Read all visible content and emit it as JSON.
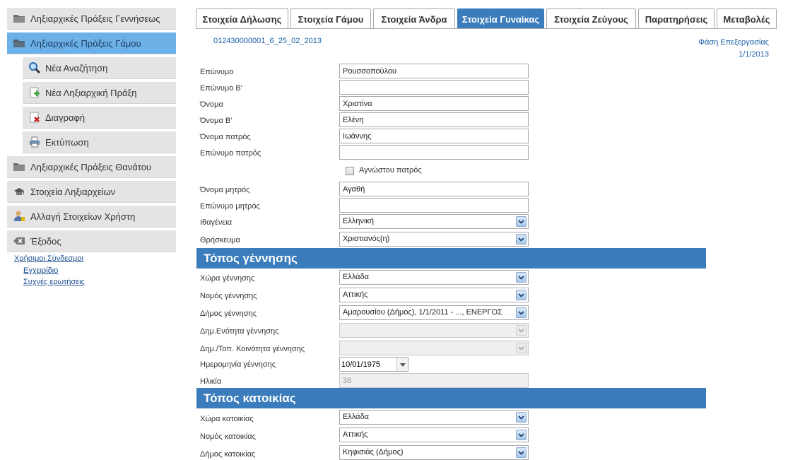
{
  "sidebar": {
    "items": [
      {
        "label": "Ληξιαρχικές Πράξεις Γεννήσεως",
        "icon": "folder-icon"
      },
      {
        "label": "Ληξιαρχικές Πράξεις Γάμου",
        "icon": "folder-icon",
        "active": true
      },
      {
        "label": "Ληξιαρχικές Πράξεις Θανάτου",
        "icon": "folder-icon"
      },
      {
        "label": "Στοιχεία Ληξιαρχείων",
        "icon": "registry-icon"
      },
      {
        "label": "Αλλαγή Στοιχείων Χρήστη",
        "icon": "user-icon"
      },
      {
        "label": "Έξοδος",
        "icon": "exit-icon"
      }
    ],
    "subitems": [
      {
        "label": "Νέα Αναζήτηση",
        "icon": "search-icon"
      },
      {
        "label": "Νέα Ληξιαρχική Πράξη",
        "icon": "add-document-icon"
      },
      {
        "label": "Διαγραφή",
        "icon": "delete-icon"
      },
      {
        "label": "Εκτύπωση",
        "icon": "print-icon"
      }
    ],
    "links_title": "Χρήσιμοι Σύνδεσμοι",
    "links": [
      "Εγχειρίδιο",
      "Συχνές ερωτήσεις"
    ]
  },
  "tabs": [
    "Στοιχεία Δήλωσης",
    "Στοιχεία Γάμου",
    "Στοιχεία Άνδρα",
    "Στοιχεία Γυναίκας",
    "Στοιχεία Ζεύγους",
    "Παρατηρήσεις",
    "Μεταβολές"
  ],
  "active_tab": "Στοιχεία Γυναίκας",
  "declaration_id": "012430000001_6_25_02_2013",
  "phase": {
    "label": "Φάση Επεξεργασίας",
    "date": "1/1/2013"
  },
  "form": {
    "surname": {
      "label": "Επώνυμο",
      "value": "Ρουσσοπούλου"
    },
    "surname_b": {
      "label": "Επώνυμο Β'",
      "value": ""
    },
    "name": {
      "label": "Όνομα",
      "value": "Χριστίνα"
    },
    "name_b": {
      "label": "Όνομα Β'",
      "value": "Ελένη"
    },
    "father_name": {
      "label": "Όνομα πατρός",
      "value": "Ιωάννης"
    },
    "father_surname": {
      "label": "Επώνυμο πατρός",
      "value": ""
    },
    "unknown_father": {
      "label": "Αγνώστου πατρός",
      "checked": false
    },
    "mother_name": {
      "label": "Όνομα μητρός",
      "value": "Αγαθή"
    },
    "mother_surname": {
      "label": "Επώνυμο μητρός",
      "value": ""
    },
    "nationality": {
      "label": "Ιθαγένεια",
      "value": "Ελληνική"
    },
    "religion": {
      "label": "Θρήσκευμα",
      "value": "Χριστιανός(η)"
    }
  },
  "birth_section": {
    "title": "Τόπος γέννησης",
    "country": {
      "label": "Χώρα γέννησης",
      "value": "Ελλάδα"
    },
    "prefecture": {
      "label": "Νομός γέννησης",
      "value": "Αττικής"
    },
    "municipality": {
      "label": "Δήμος γέννησης",
      "value": "Αμαρουσίου (Δήμος), 1/1/2011 - ..., ΕΝΕΡΓΟΣ"
    },
    "municipal_unit": {
      "label": "Δημ.Ενότητα γέννησης",
      "value": ""
    },
    "community": {
      "label": "Δημ./Τοπ. Κοινότητα γέννησης",
      "value": ""
    },
    "birth_date": {
      "label": "Ημερομηνία γέννησης",
      "value": "10/01/1975"
    },
    "age": {
      "label": "Ηλικία",
      "value": "38"
    }
  },
  "residence_section": {
    "title": "Τόπος κατοικίας",
    "country": {
      "label": "Χώρα κατοικίας",
      "value": "Ελλάδα"
    },
    "prefecture": {
      "label": "Νομός κατοικίας",
      "value": "Αττικής"
    },
    "municipality": {
      "label": "Δήμος κατοικίας",
      "value": "Κηφισιάς (Δήμος)"
    }
  },
  "colors": {
    "accent": "#3b7cbc",
    "sidebar_active": "#6cb0e8",
    "link": "#1a4d8f"
  }
}
